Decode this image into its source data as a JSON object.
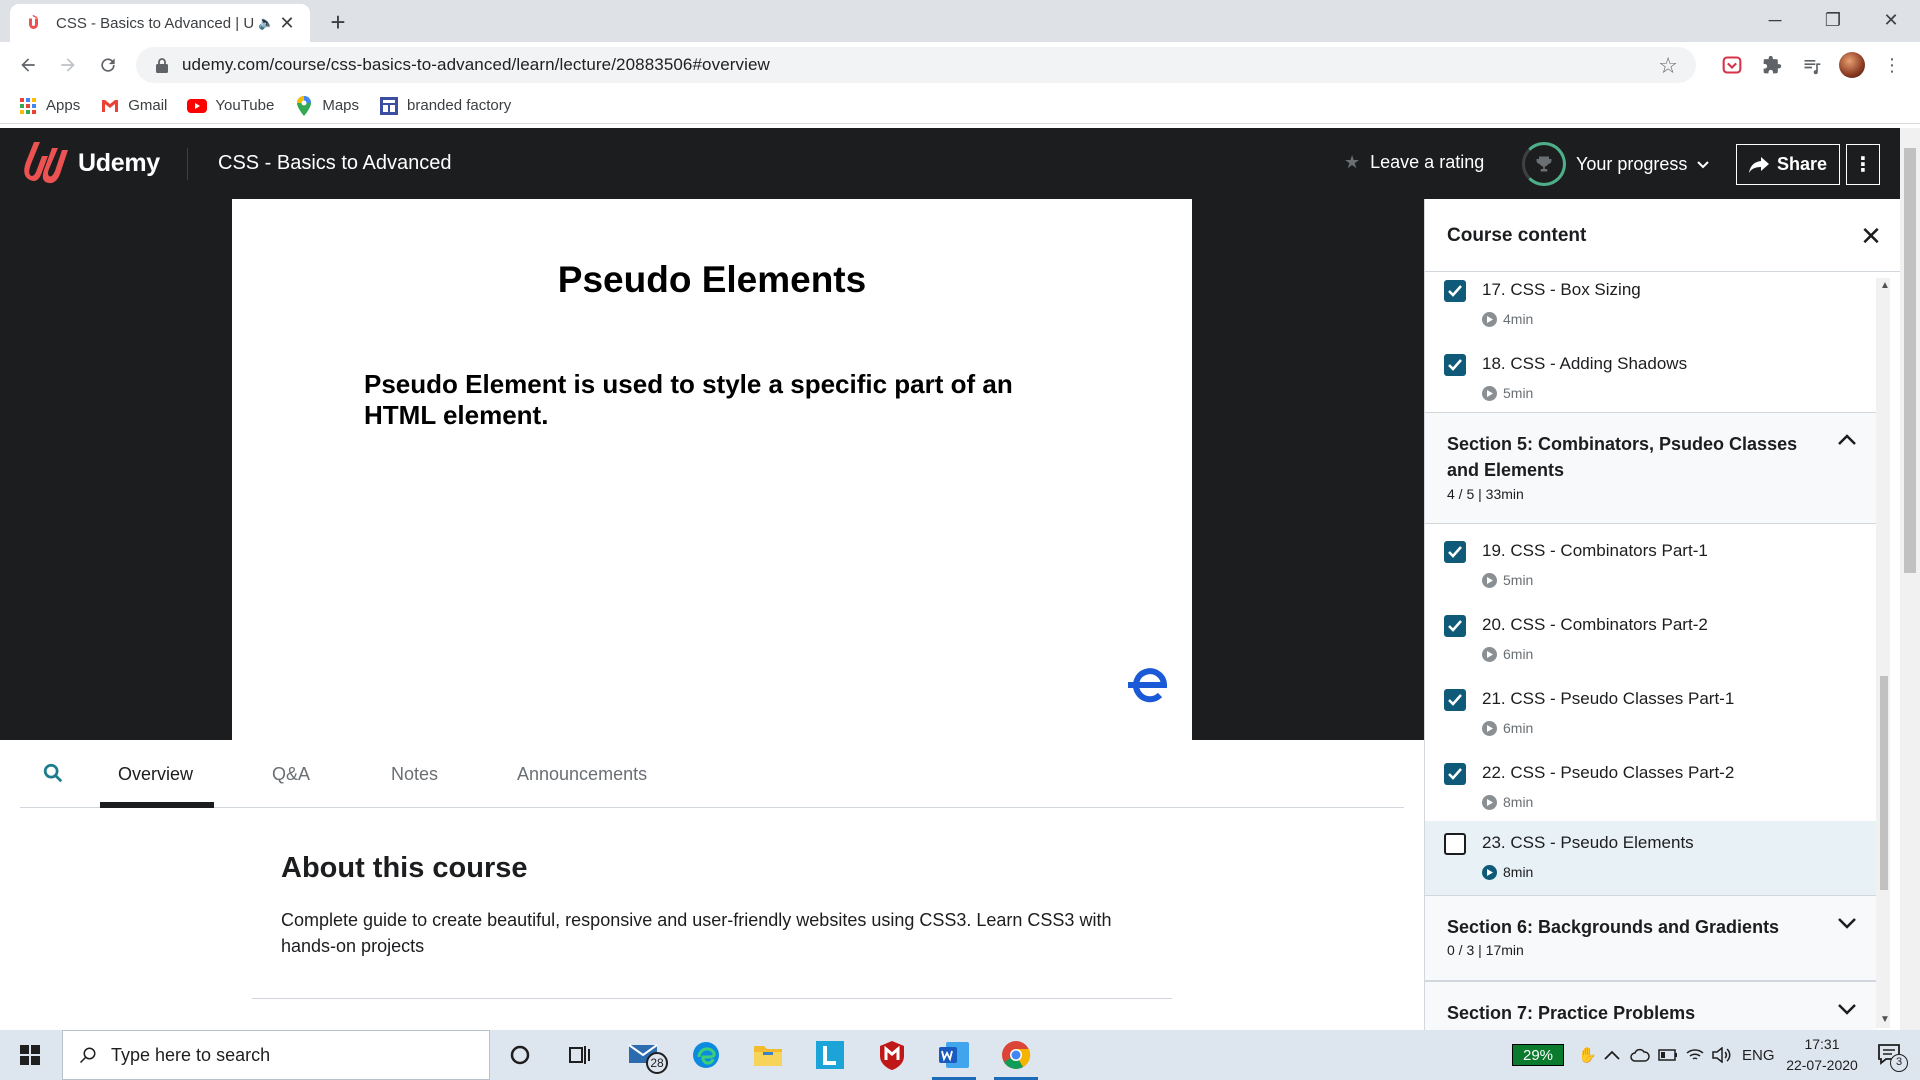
{
  "browser": {
    "tab_title": "CSS - Basics to Advanced | U",
    "url": "udemy.com/course/css-basics-to-advanced/learn/lecture/20883506#overview",
    "bookmarks": [
      {
        "label": "Apps",
        "icon": "apps-grid-icon"
      },
      {
        "label": "Gmail",
        "icon": "gmail-icon"
      },
      {
        "label": "YouTube",
        "icon": "youtube-icon"
      },
      {
        "label": "Maps",
        "icon": "maps-pin-icon"
      },
      {
        "label": "branded factory",
        "icon": "branded-factory-icon"
      }
    ]
  },
  "header": {
    "brand": "Udemy",
    "course_title": "CSS - Basics to Advanced",
    "leave_rating": "Leave a rating",
    "your_progress": "Your progress",
    "share": "Share",
    "brand_color": "#ec5252",
    "bg_color": "#1c1d1f"
  },
  "slide": {
    "title": "Pseudo Elements",
    "body": "Pseudo Element is used to style a specific part of an HTML element."
  },
  "tabs": {
    "overview": "Overview",
    "qa": "Q&A",
    "notes": "Notes",
    "announcements": "Announcements",
    "active": "Overview"
  },
  "about": {
    "heading": "About this course",
    "description": "Complete guide to create beautiful, responsive and user-friendly websites using CSS3. Learn CSS3 with hands-on projects"
  },
  "sidebar": {
    "title": "Course content",
    "lectures_top": [
      {
        "title": "17. CSS - Box Sizing",
        "duration": "4min",
        "done": true
      },
      {
        "title": "18. CSS - Adding Shadows",
        "duration": "5min",
        "done": true
      }
    ],
    "section5": {
      "title": "Section 5: Combinators, Psudeo Classes and Elements",
      "meta": "4 / 5 | 33min",
      "expanded": true
    },
    "lectures_s5": [
      {
        "title": "19. CSS - Combinators Part-1",
        "duration": "5min",
        "done": true
      },
      {
        "title": "20. CSS - Combinators Part-2",
        "duration": "6min",
        "done": true
      },
      {
        "title": "21. CSS - Pseudo Classes Part-1",
        "duration": "6min",
        "done": true
      },
      {
        "title": "22. CSS - Pseudo Classes Part-2",
        "duration": "8min",
        "done": true
      },
      {
        "title": "23. CSS - Pseudo Elements",
        "duration": "8min",
        "done": false,
        "current": true
      }
    ],
    "section6": {
      "title": "Section 6: Backgrounds and Gradients",
      "meta": "0 / 3 | 17min"
    },
    "section7": {
      "title": "Section 7: Practice Problems"
    },
    "check_color": "#0f5a78"
  },
  "taskbar": {
    "search_placeholder": "Type here to search",
    "mail_badge": "28",
    "battery": "29%",
    "language": "ENG",
    "time": "17:31",
    "date": "22-07-2020",
    "notifications": "3",
    "apps": [
      "cortana-icon",
      "task-view-icon",
      "mail-icon",
      "edge-icon",
      "file-explorer-icon",
      "l-app-icon",
      "mcafee-icon",
      "word-icon",
      "chrome-icon"
    ]
  }
}
